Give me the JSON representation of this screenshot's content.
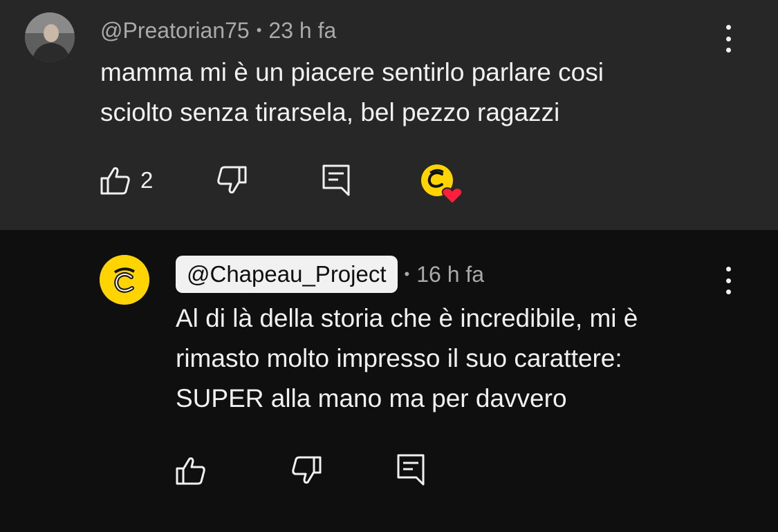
{
  "main_comment": {
    "author": "@Preatorian75",
    "separator": "•",
    "time": "23 h fa",
    "text": "mamma mi è un piacere sentirlo parlare cosi\nsciolto senza tirarsela, bel pezzo ragazzi",
    "like_count": "2",
    "creator_heart": true
  },
  "reply_comment": {
    "author": "@Chapeau_Project",
    "separator": "•",
    "time": "16 h fa",
    "text": "Al di là della storia che è incredibile, mi è\nrimasto molto impresso il suo carattere:\nSUPER alla mano ma per davvero"
  },
  "icons": {
    "like": "thumbs-up-icon",
    "dislike": "thumbs-down-icon",
    "reply": "comment-icon",
    "menu": "more-vertical-icon",
    "heart": "creator-heart-icon"
  },
  "colors": {
    "main_bg": "#272727",
    "reply_bg": "#0f0f0f",
    "text": "#f1f1f1",
    "meta": "#aaaaaa",
    "channel_yellow": "#ffd400",
    "heart_red": "#ff1f3d"
  }
}
